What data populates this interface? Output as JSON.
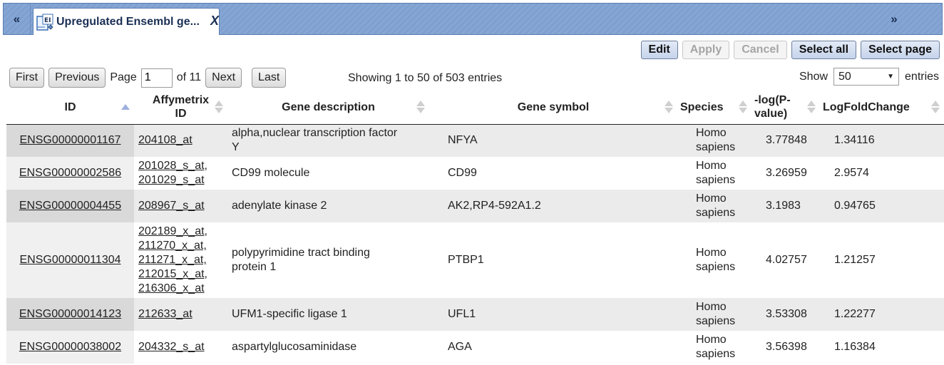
{
  "tabbar": {
    "nav_left": "«",
    "nav_right": "»",
    "tab_title": "Upregulated Ensembl ge...",
    "tab_close": "X",
    "tab_icon_text": "EI"
  },
  "toolbar": {
    "edit": "Edit",
    "apply": "Apply",
    "cancel": "Cancel",
    "select_all": "Select all",
    "select_page": "Select page"
  },
  "pager": {
    "first": "First",
    "previous": "Previous",
    "page_label": "Page",
    "page_value": "1",
    "of_label": "of 11",
    "next": "Next",
    "last": "Last"
  },
  "showing": "Showing 1 to 50 of 503 entries",
  "show": {
    "label": "Show",
    "value": "50",
    "entries": "entries"
  },
  "table": {
    "headers": {
      "id": "ID",
      "affy_1": "Affymetrix",
      "affy_2": "ID",
      "desc": "Gene description",
      "symbol": "Gene symbol",
      "species": "Species",
      "logp_1": "-log(P-",
      "logp_2": "value)",
      "lfc": "LogFoldChange"
    },
    "rows": [
      {
        "id": "ENSG00000001167",
        "affy": [
          "204108_at"
        ],
        "desc_1": "alpha,nuclear transcription factor",
        "desc_2": "Y",
        "symbol": "NFYA",
        "species_1": "Homo",
        "species_2": "sapiens",
        "logp": "3.77848",
        "lfc": "1.34116"
      },
      {
        "id": "ENSG00000002586",
        "affy": [
          "201028_s_at,",
          "201029_s_at"
        ],
        "desc_1": "CD99 molecule",
        "desc_2": "",
        "symbol": "CD99",
        "species_1": "Homo",
        "species_2": "sapiens",
        "logp": "3.26959",
        "lfc": "2.9574"
      },
      {
        "id": "ENSG00000004455",
        "affy": [
          "208967_s_at"
        ],
        "desc_1": "adenylate kinase 2",
        "desc_2": "",
        "symbol": "AK2,RP4-592A1.2",
        "species_1": "Homo",
        "species_2": "sapiens",
        "logp": "3.1983",
        "lfc": "0.94765"
      },
      {
        "id": "ENSG00000011304",
        "affy": [
          "202189_x_at,",
          "211270_x_at,",
          "211271_x_at,",
          "212015_x_at,",
          "216306_x_at"
        ],
        "desc_1": "polypyrimidine tract binding",
        "desc_2": "protein 1",
        "symbol": "PTBP1",
        "species_1": "Homo",
        "species_2": "sapiens",
        "logp": "4.02757",
        "lfc": "1.21257"
      },
      {
        "id": "ENSG00000014123",
        "affy": [
          "212633_at"
        ],
        "desc_1": "UFM1-specific ligase 1",
        "desc_2": "",
        "symbol": "UFL1",
        "species_1": "Homo",
        "species_2": "sapiens",
        "logp": "3.53308",
        "lfc": "1.22277"
      },
      {
        "id": "ENSG00000038002",
        "affy": [
          "204332_s_at"
        ],
        "desc_1": "aspartylglucosaminidase",
        "desc_2": "",
        "symbol": "AGA",
        "species_1": "Homo",
        "species_2": "sapiens",
        "logp": "3.56398",
        "lfc": "1.16384"
      }
    ]
  },
  "colors": {
    "tabbar_bg": "#7fa0cf",
    "row_odd": "#ebebeb",
    "id_col_odd": "#d9d9d9",
    "sort_active": "#9eb0e0"
  },
  "icons": {
    "tab_icon": "ensembl-doc-icon",
    "sort_id": "sort-ascending-icon",
    "sort_other": "sort-both-icon",
    "select_arrow": "dropdown-arrow-icon"
  }
}
